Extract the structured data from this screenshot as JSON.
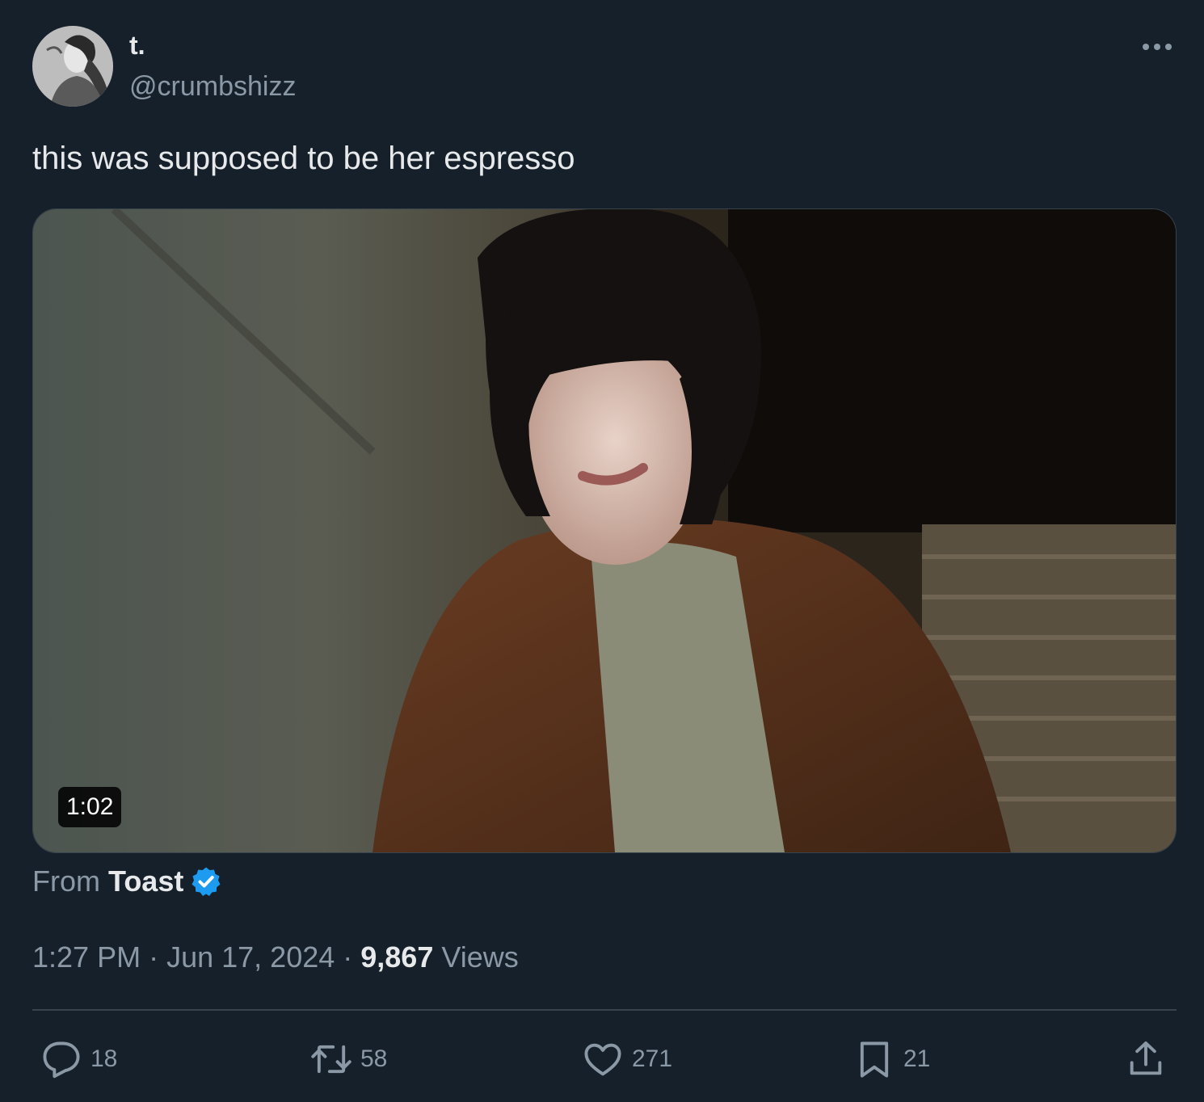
{
  "author": {
    "display_name": "t.",
    "handle": "@crumbshizz"
  },
  "menu": {
    "icon": "more-horizontal-icon"
  },
  "tweet": {
    "text": "this was supposed to be her espresso"
  },
  "media": {
    "type": "video",
    "duration": "1:02"
  },
  "source": {
    "prefix": "From",
    "name": "Toast",
    "verified": true,
    "verified_color": "#1d9bf0"
  },
  "meta": {
    "time": "1:27 PM",
    "separator": "·",
    "date": "Jun 17, 2024",
    "views_count": "9,867",
    "views_label": "Views"
  },
  "actions": {
    "reply": {
      "icon": "reply-icon",
      "count": "18"
    },
    "retweet": {
      "icon": "retweet-icon",
      "count": "58"
    },
    "like": {
      "icon": "heart-icon",
      "count": "271"
    },
    "bookmark": {
      "icon": "bookmark-icon",
      "count": "21"
    },
    "share": {
      "icon": "share-icon"
    }
  },
  "colors": {
    "background": "#15202b",
    "primary_text": "#e7e9ea",
    "secondary_text": "#8b98a5",
    "divider": "#38444d",
    "accent": "#1d9bf0"
  }
}
